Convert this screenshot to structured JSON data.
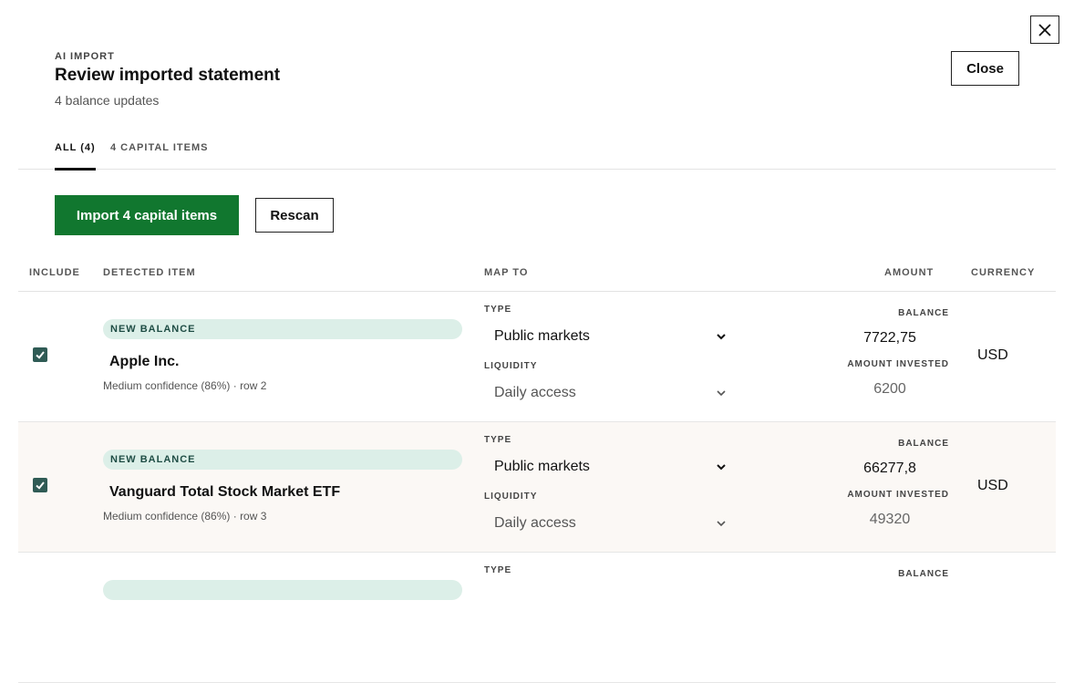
{
  "header": {
    "eyebrow": "AI IMPORT",
    "title": "Review imported statement",
    "subtitle": "4 balance updates",
    "close_label": "Close"
  },
  "tabs": [
    {
      "label": "ALL (4)",
      "active": true
    },
    {
      "label": "4 CAPITAL ITEMS",
      "active": false
    }
  ],
  "actions": {
    "import_label": "Import 4 capital items",
    "rescan_label": "Rescan"
  },
  "table": {
    "columns": {
      "include": "INCLUDE",
      "detected": "DETECTED ITEM",
      "map_to": "MAP TO",
      "amount": "AMOUNT",
      "currency": "CURRENCY"
    },
    "field_labels": {
      "type": "TYPE",
      "liquidity": "LIQUIDITY",
      "balance": "BALANCE",
      "amount_invested": "AMOUNT INVESTED"
    },
    "rows": [
      {
        "included": true,
        "badge": "NEW BALANCE",
        "name": "Apple Inc.",
        "meta": "Medium confidence (86%) · row 2",
        "type": "Public markets",
        "liquidity": "Daily access",
        "balance": "7722,75",
        "amount_invested": "6200",
        "currency": "USD"
      },
      {
        "included": true,
        "badge": "NEW BALANCE",
        "name": "Vanguard Total Stock Market ETF",
        "meta": "Medium confidence (86%) · row 3",
        "type": "Public markets",
        "liquidity": "Daily access",
        "balance": "66277,8",
        "amount_invested": "49320",
        "currency": "USD"
      },
      {
        "badge": "",
        "name": "",
        "meta": "",
        "type": "",
        "liquidity": "",
        "balance": "",
        "amount_invested": "",
        "currency": ""
      }
    ]
  },
  "colors": {
    "primary_green": "#11772f",
    "checkbox": "#2f5b55",
    "badge_bg": "#dcefe8",
    "badge_text": "#1f4d45",
    "alt_row_bg": "#fbf8f5"
  },
  "icons": {
    "close": "close-icon",
    "chevron": "chevron-down-icon",
    "check": "check-icon"
  }
}
